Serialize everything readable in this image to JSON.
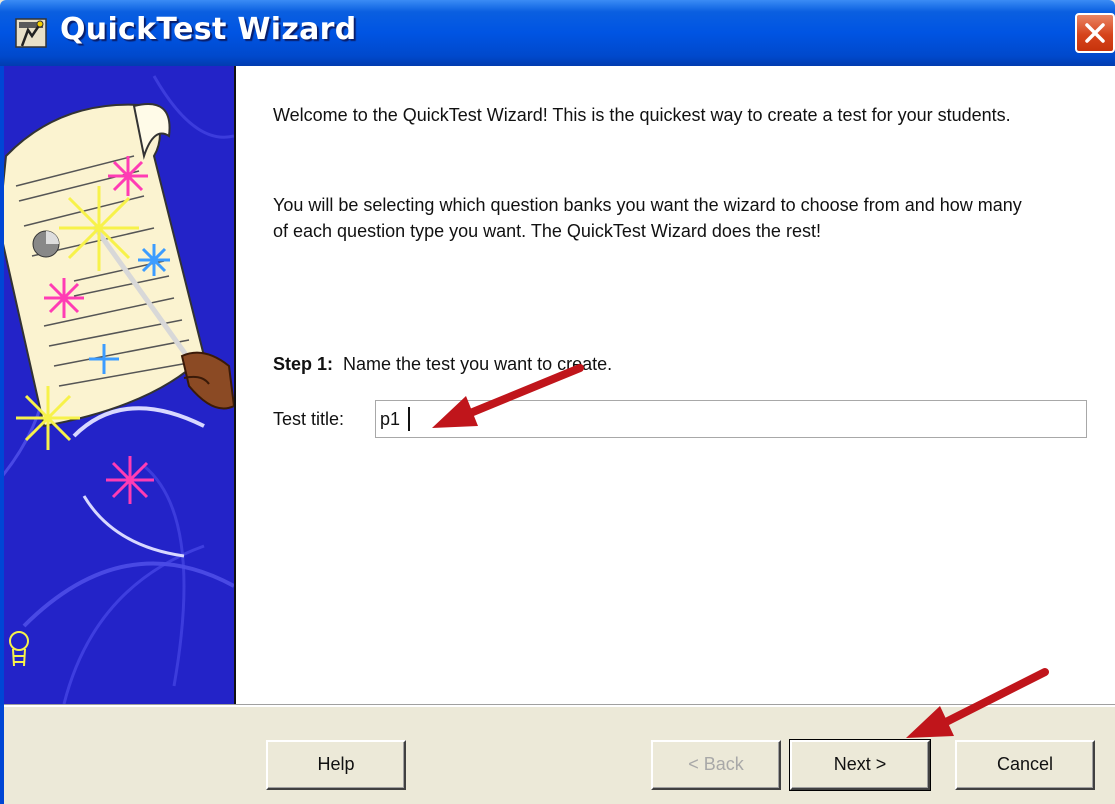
{
  "window": {
    "title": "QuickTest Wizard"
  },
  "content": {
    "welcome_text": "Welcome to the QuickTest Wizard!  This is the quickest way to create a test for your students.",
    "instructions_text": "You will be selecting which question banks you want the wizard to choose from and how many of each question type you want.  The QuickTest Wizard does the rest!",
    "step1_label": "Step 1:",
    "step1_text": "Name the test you want to create.",
    "test_title_label": "Test title:",
    "test_title_value": "p1"
  },
  "buttons": {
    "help": "Help",
    "back": "< Back",
    "next": "Next >",
    "cancel": "Cancel"
  },
  "icons": {
    "app": "wizard-app-icon",
    "close": "close-icon",
    "lightbulb": "lightbulb-icon"
  },
  "colors": {
    "titlebar": "#0054e3",
    "side_panel": "#2323c8",
    "annotation_arrow": "#c0151b"
  }
}
